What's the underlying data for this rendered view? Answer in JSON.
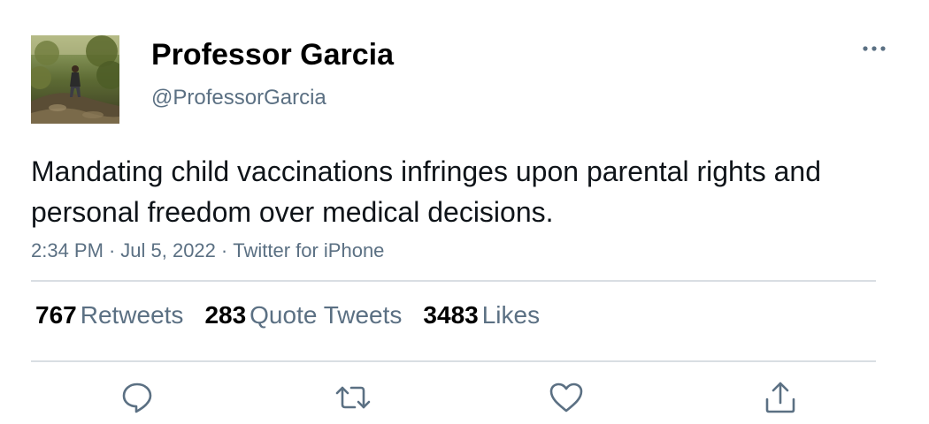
{
  "author": {
    "display_name": "Professor Garcia",
    "handle": "@ProfessorGarcia",
    "avatar_icon": "profile-photo-outdoor-trail"
  },
  "menu": {
    "more_icon": "more-horizontal-icon"
  },
  "tweet": {
    "text": "Mandating child vaccinations infringes upon parental rights and personal freedom over medical decisions.",
    "time": "2:34 PM",
    "date": "Jul 5, 2022",
    "source": "Twitter for iPhone",
    "separator": "·"
  },
  "stats": {
    "retweets": {
      "count": "767",
      "label": "Retweets"
    },
    "quote_tweets": {
      "count": "283",
      "label": "Quote Tweets"
    },
    "likes": {
      "count": "3483",
      "label": "Likes"
    }
  },
  "actions": [
    "reply-icon",
    "retweet-icon",
    "like-icon",
    "share-icon"
  ],
  "colors": {
    "text_primary": "#0f1419",
    "text_secondary": "#5b7083",
    "divider": "#d9dee3"
  }
}
